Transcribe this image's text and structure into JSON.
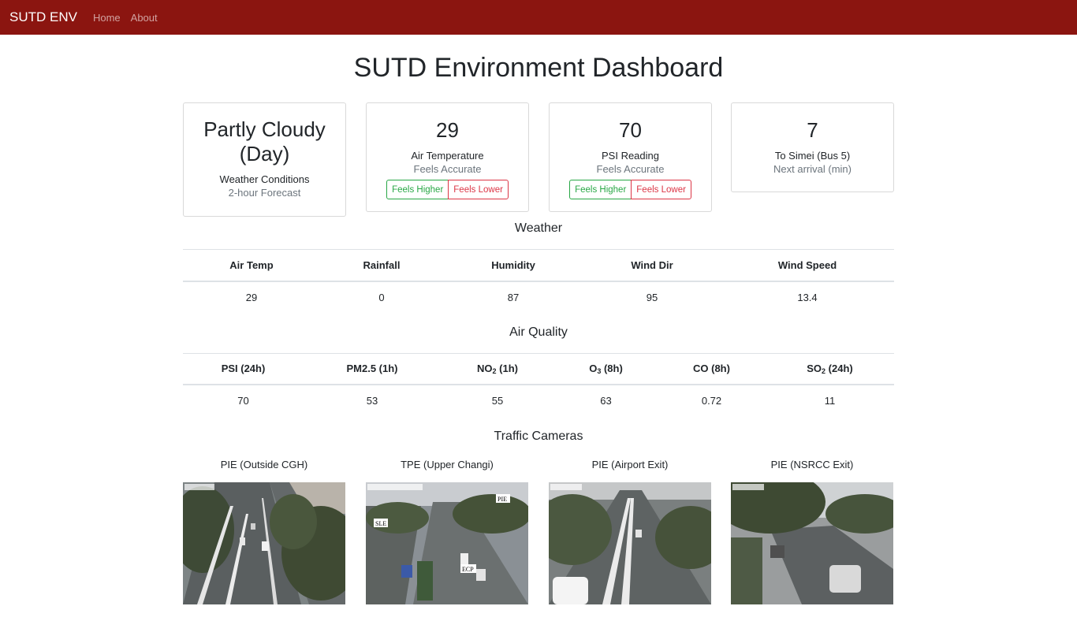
{
  "nav": {
    "brand": "SUTD ENV",
    "links": [
      "Home",
      "About"
    ],
    "bg_color": "#8b1510"
  },
  "page": {
    "title": "SUTD Environment Dashboard"
  },
  "cards": [
    {
      "value": "Partly Cloudy (Day)",
      "label": "Weather Conditions",
      "sub": "2-hour Forecast"
    },
    {
      "value": "29",
      "label": "Air Temperature",
      "sub": "Feels Accurate",
      "buttons": [
        "Feels Higher",
        "Feels Lower"
      ]
    },
    {
      "value": "70",
      "label": "PSI Reading",
      "sub": "Feels Accurate",
      "buttons": [
        "Feels Higher",
        "Feels Lower"
      ]
    },
    {
      "value": "7",
      "label": "To Simei (Bus 5)",
      "sub": "Next arrival (min)"
    }
  ],
  "weather": {
    "title": "Weather",
    "headers": [
      "Air Temp",
      "Rainfall",
      "Humidity",
      "Wind Dir",
      "Wind Speed"
    ],
    "values": [
      "29",
      "0",
      "87",
      "95",
      "13.4"
    ]
  },
  "air_quality": {
    "title": "Air Quality",
    "headers": [
      {
        "text": "PSI (24h)"
      },
      {
        "text": "PM2.5 (1h)"
      },
      {
        "pre": "NO",
        "sub": "2",
        "post": " (1h)"
      },
      {
        "pre": "O",
        "sub": "3",
        "post": " (8h)"
      },
      {
        "text": "CO (8h)"
      },
      {
        "pre": "SO",
        "sub": "2",
        "post": " (24h)"
      }
    ],
    "values": [
      "70",
      "53",
      "55",
      "63",
      "0.72",
      "11"
    ]
  },
  "traffic": {
    "title": "Traffic Cameras",
    "cameras": [
      {
        "label": "PIE (Outside CGH)"
      },
      {
        "label": "TPE (Upper Changi)",
        "overlays": [
          "PIE",
          "SLE",
          "ECP"
        ]
      },
      {
        "label": "PIE (Airport Exit)"
      },
      {
        "label": "PIE (NSRCC Exit)"
      }
    ]
  },
  "colors": {
    "accent_green": "#28a745",
    "accent_red": "#dc3545",
    "muted": "#6c757d"
  }
}
